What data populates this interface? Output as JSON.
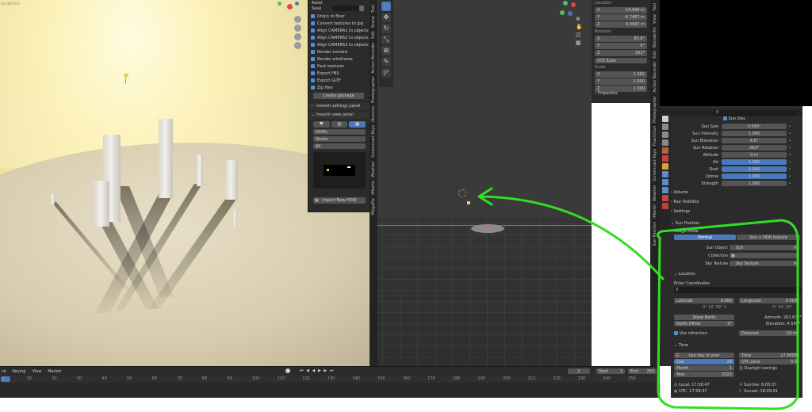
{
  "left_view": {
    "corner_text": "ple 08/2024"
  },
  "plugin_panel": {
    "header_label": "Asset",
    "save_label": "Save",
    "checkboxes": [
      "Origin to floor",
      "Convert textures to jpg",
      "Align CAMERA1 to objects",
      "Align CAMERA2 to objects",
      "Align CAMERA3 to objects",
      "Render comera",
      "Render wireframe",
      "Pack textures",
      "Export FBX",
      "Export GLTF",
      "Zip files"
    ],
    "create_button": "Create package",
    "settings_panel": "imeshh settings panel",
    "view_panel": "imeshh view panel",
    "hdri_dropdown": "HDRIs",
    "studio_dropdown": "Studio",
    "all_dropdown": "All",
    "import_button": "Import New HDRI"
  },
  "left_tabs": [
    "Tool",
    "Scene",
    "Edit",
    "Action Recorder",
    "Photographer",
    "Illumino",
    "Screencast Keys",
    "Weather",
    "iMeshh",
    "MegaPie"
  ],
  "transform": {
    "location_label": "Location",
    "location": [
      {
        "axis": "X",
        "value": "-19.996 m"
      },
      {
        "axis": "Y",
        "value": "-6.7467 m"
      },
      {
        "axis": "Z",
        "value": "4.0087 m"
      }
    ],
    "rotation_label": "Rotation",
    "rotation": [
      {
        "axis": "X",
        "value": "85.8°"
      },
      {
        "axis": "Y",
        "value": "0°"
      },
      {
        "axis": "Z",
        "value": "263°"
      }
    ],
    "euler": "XYZ Euler",
    "scale_label": "Scale",
    "scale": [
      {
        "axis": "X",
        "value": "1.000"
      },
      {
        "axis": "Y",
        "value": "1.000"
      },
      {
        "axis": "Z",
        "value": "1.000"
      }
    ],
    "properties_label": "Properties"
  },
  "right_tabs": [
    "Tool",
    "View",
    "BlenderKit",
    "Edit",
    "Action Recorder",
    "Photographer",
    "FluentSun",
    "Screencast Keys",
    "Weather",
    "iMeshh",
    "Sun Position"
  ],
  "sky": {
    "sun_disc_label": "Sun Disc",
    "rows": [
      {
        "label": "Sun Size",
        "value": "0.545°"
      },
      {
        "label": "Sun Intensity",
        "value": "1.000"
      },
      {
        "label": "Sun Elevation",
        "value": "4.6°"
      },
      {
        "label": "Sun Rotation",
        "value": "263°"
      },
      {
        "label": "Altitude",
        "value": "0 m"
      },
      {
        "label": "Air",
        "value": "1.000"
      },
      {
        "label": "Dust",
        "value": "1.000"
      },
      {
        "label": "Ozone",
        "value": "1.000"
      },
      {
        "label": "Strength",
        "value": "1.000"
      }
    ],
    "sections": [
      "Volume",
      "Ray Visibility",
      "Settings"
    ]
  },
  "sun_position": {
    "header": "Sun Position",
    "usage_mode_label": "Usage Mode",
    "mode_normal": "Normal",
    "mode_sun_hdr": "Sun + HDR texture",
    "sun_object_label": "Sun Object",
    "sun_object_value": "Sun",
    "collection_label": "Collection",
    "sky_texture_label": "Sky Texture",
    "sky_texture_value": "Sky Texture",
    "location_header": "Location",
    "enter_coordinates": "Enter Coordinates",
    "latitude_label": "Latitude",
    "latitude_value": "0.000",
    "latitude_dms": "0° 10' 59\" S",
    "longitude_label": "Longitude",
    "longitude_value": "0.000",
    "longitude_dms": "0° 00' 00\"",
    "show_north": "Show North",
    "north_offset_label": "North Offset",
    "north_offset_value": "0°",
    "azimuth": "Azimuth: 262.602°",
    "elevation": "Elevation: 4.599°",
    "use_refraction": "Use refraction",
    "distance_label": "Distance",
    "distance_value": "50 m",
    "time_header": "Time",
    "use_day_of_year": "Use day of year",
    "day_label": "Day",
    "day_value": "29",
    "month_label": "Month",
    "month_value": "1",
    "year_label": "Year",
    "year_value": "2023",
    "time_label": "Time",
    "time_value": "17.9800",
    "utc_zone_label": "UTC zone",
    "utc_zone_value": "0.0",
    "daylight_savings": "Daylight savings",
    "local_label": "Local: 17:58:47",
    "utc_label": "UTC: 17:58:47",
    "sunrise_label": "Sunrise: 6:03:37",
    "sunset_label": "Sunset: 18:29:01"
  },
  "timeline": {
    "menu": [
      "ck",
      "Keying",
      "View",
      "Marker"
    ],
    "current_frame": "1",
    "start_label": "Start",
    "start_value": "1",
    "end_label": "End",
    "end_value": "250",
    "ticks": [
      "0",
      "10",
      "20",
      "30",
      "40",
      "50",
      "60",
      "70",
      "80",
      "90",
      "100",
      "110",
      "120",
      "130",
      "140",
      "150",
      "160",
      "170",
      "180",
      "190",
      "200",
      "210",
      "220",
      "230",
      "240",
      "250"
    ]
  },
  "colors": {
    "accent_blue": "#4a78b8",
    "annotation_green": "#33dd22",
    "panel_bg": "#2b2b2b",
    "field_bg": "#545454"
  }
}
